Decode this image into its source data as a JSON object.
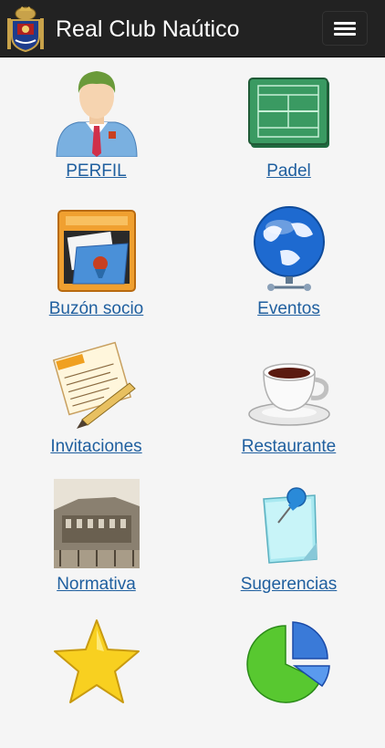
{
  "header": {
    "title": "Real Club Naútico",
    "logo_icon": "club-crest-icon",
    "menu_icon": "hamburger-menu-icon"
  },
  "menu": [
    {
      "label": "PERFIL",
      "icon": "profile-user-icon"
    },
    {
      "label": "Padel",
      "icon": "padel-court-icon"
    },
    {
      "label": "Buzón socio",
      "icon": "mailbox-folder-icon"
    },
    {
      "label": "Eventos",
      "icon": "globe-network-icon"
    },
    {
      "label": "Invitaciones",
      "icon": "document-pen-icon"
    },
    {
      "label": "Restaurante",
      "icon": "coffee-cup-icon"
    },
    {
      "label": "Normativa",
      "icon": "historic-building-photo"
    },
    {
      "label": "Sugerencias",
      "icon": "sticky-note-pin-icon"
    },
    {
      "label": "",
      "icon": "star-icon"
    },
    {
      "label": "",
      "icon": "pie-chart-icon"
    }
  ]
}
